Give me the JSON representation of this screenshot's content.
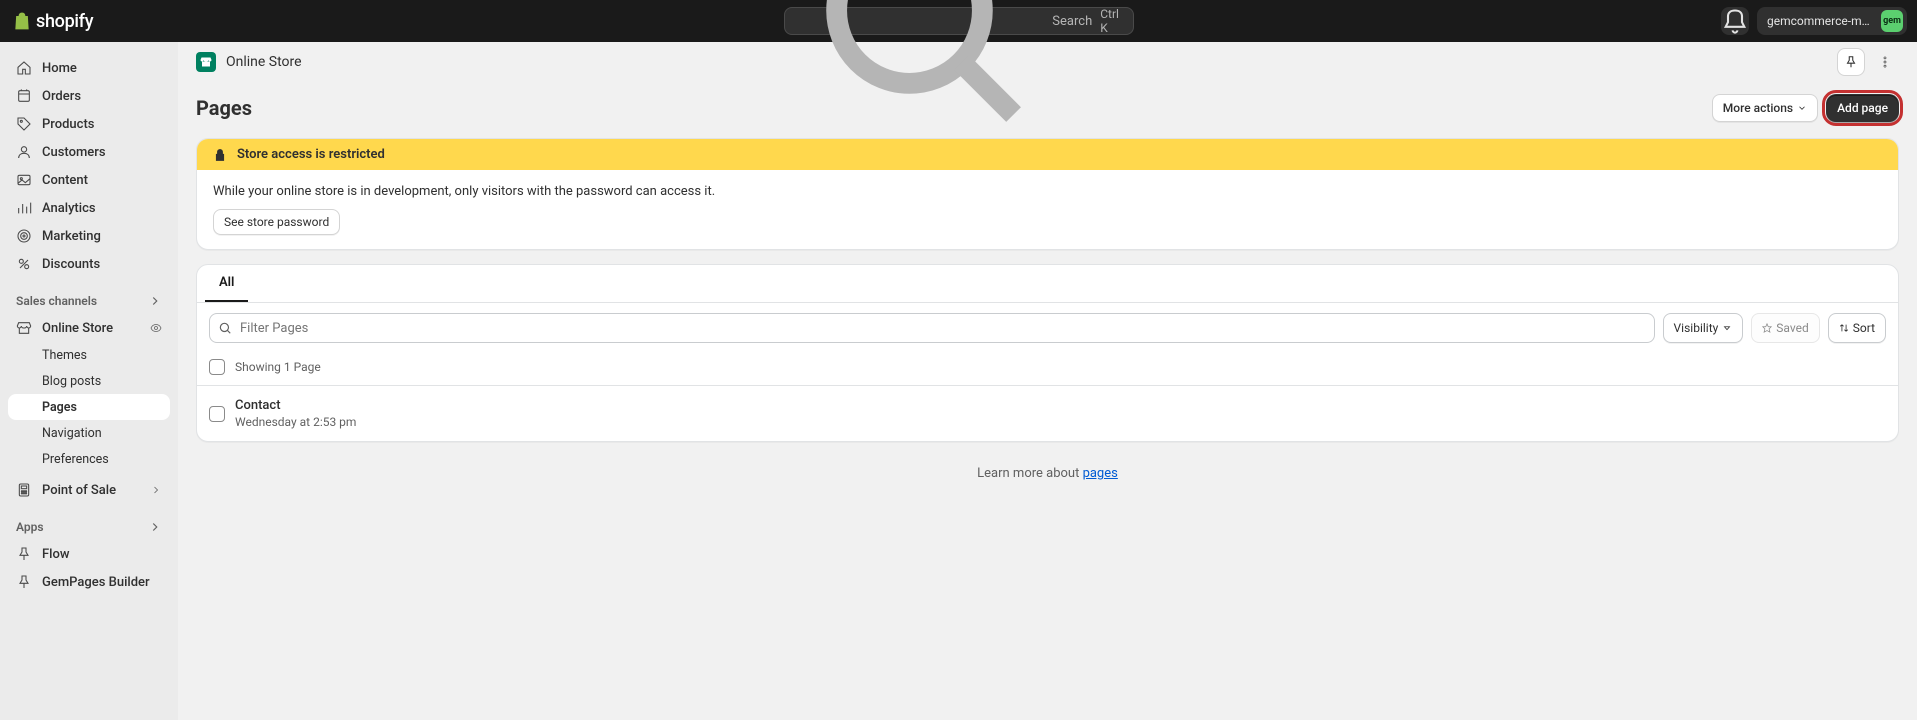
{
  "topbar": {
    "brand": "shopify",
    "search_placeholder": "Search",
    "shortcut": "Ctrl K",
    "store_name": "gemcommerce-marke...",
    "avatar_initials": "gem"
  },
  "sidebar": {
    "main": [
      {
        "label": "Home"
      },
      {
        "label": "Orders"
      },
      {
        "label": "Products"
      },
      {
        "label": "Customers"
      },
      {
        "label": "Content"
      },
      {
        "label": "Analytics"
      },
      {
        "label": "Marketing"
      },
      {
        "label": "Discounts"
      }
    ],
    "channels_label": "Sales channels",
    "channels": [
      {
        "label": "Online Store"
      }
    ],
    "online_store_sub": [
      {
        "label": "Themes"
      },
      {
        "label": "Blog posts"
      },
      {
        "label": "Pages"
      },
      {
        "label": "Navigation"
      },
      {
        "label": "Preferences"
      }
    ],
    "pos": {
      "label": "Point of Sale"
    },
    "apps_label": "Apps",
    "apps": [
      {
        "label": "Flow"
      },
      {
        "label": "GemPages Builder"
      }
    ]
  },
  "page": {
    "breadcrumb": "Online Store",
    "title": "Pages",
    "actions": {
      "more": "More actions",
      "add": "Add page"
    }
  },
  "restriction_card": {
    "banner": "Store access is restricted",
    "body": "While your online store is in development, only visitors with the password can access it.",
    "button": "See store password"
  },
  "list_card": {
    "tab_all": "All",
    "filter_placeholder": "Filter Pages",
    "visibility": "Visibility",
    "saved": "Saved",
    "sort": "Sort",
    "showing": "Showing 1 Page",
    "rows": [
      {
        "title": "Contact",
        "subtitle": "Wednesday at 2:53 pm"
      }
    ]
  },
  "learn_more": {
    "prefix": "Learn more about ",
    "link": "pages"
  }
}
